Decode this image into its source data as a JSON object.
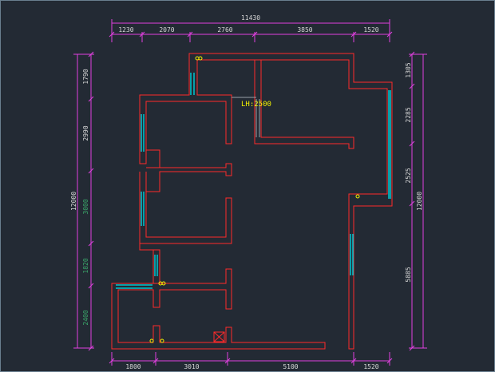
{
  "colors": {
    "background": "#232a34",
    "wall": "#ff2a2a",
    "dimension": "#e040e0",
    "window": "#00c8d2",
    "text": "#d8d8d8",
    "text_green": "#3aa86a",
    "annotation": "#f2f200",
    "frame": "#6a7f8f"
  },
  "top_dimensions": {
    "overall": "11430",
    "segments": [
      "1230",
      "2070",
      "2760",
      "3850",
      "1520"
    ]
  },
  "bottom_dimensions": {
    "segments": [
      "1800",
      "3010",
      "5100",
      "1520"
    ]
  },
  "left_dimensions": {
    "overall": "12000",
    "segments": [
      "1790",
      "2990",
      "3000",
      "1820",
      "2400"
    ]
  },
  "right_dimensions": {
    "overall": "12000",
    "segments": [
      "1305",
      "2285",
      "2525",
      "5885"
    ]
  },
  "annotations": {
    "height_note": "LH:2500"
  }
}
